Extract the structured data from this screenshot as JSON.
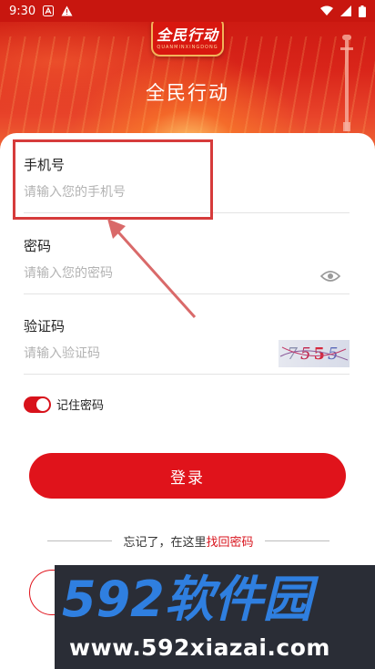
{
  "status_bar": {
    "time": "9:30"
  },
  "header": {
    "logo_text": "全民行动",
    "logo_subtext": "QUANMINXINGDONG",
    "title": "全民行动"
  },
  "form": {
    "phone": {
      "label": "手机号",
      "placeholder": "请输入您的手机号"
    },
    "password": {
      "label": "密码",
      "placeholder": "请输入您的密码"
    },
    "captcha": {
      "label": "验证码",
      "placeholder": "请输入验证码",
      "chars": [
        "7",
        "5",
        "5",
        "5"
      ]
    },
    "remember_label": "记住密码",
    "remember_checked": true,
    "login_label": "登录"
  },
  "forgot": {
    "text": "忘记了，在这里",
    "link": "找回密码"
  },
  "watermark": {
    "logo_text": "592软件园",
    "url": "www.592xiazai.com"
  },
  "colors": {
    "accent": "#e0131b",
    "header_top": "#c8160f",
    "highlight": "#d63b3b"
  }
}
